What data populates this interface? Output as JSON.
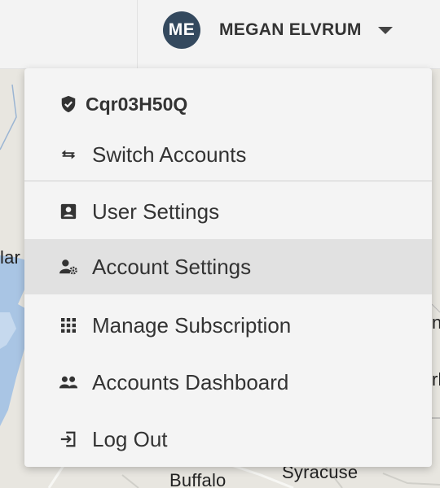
{
  "user": {
    "initials": "ME",
    "name": "MEGAN ELVRUM"
  },
  "menu": {
    "account_id": "Cqr03H50Q",
    "items": [
      {
        "label": "Switch Accounts",
        "icon": "swap-arrows-icon"
      },
      {
        "label": "User Settings",
        "icon": "user-card-icon"
      },
      {
        "label": "Account Settings",
        "icon": "user-gear-icon",
        "highlighted": true
      },
      {
        "label": "Manage Subscription",
        "icon": "grid-icon"
      },
      {
        "label": "Accounts Dashboard",
        "icon": "users-icon"
      },
      {
        "label": "Log Out",
        "icon": "logout-icon"
      }
    ]
  },
  "map": {
    "labels": [
      "lar",
      "nt",
      "rl",
      "Buffalo",
      "Syracuse"
    ]
  },
  "colors": {
    "avatar": "#34495e",
    "menu_bg": "#f4f4f4",
    "highlight": "#e1e1e1",
    "water": "#a9c5e4"
  }
}
